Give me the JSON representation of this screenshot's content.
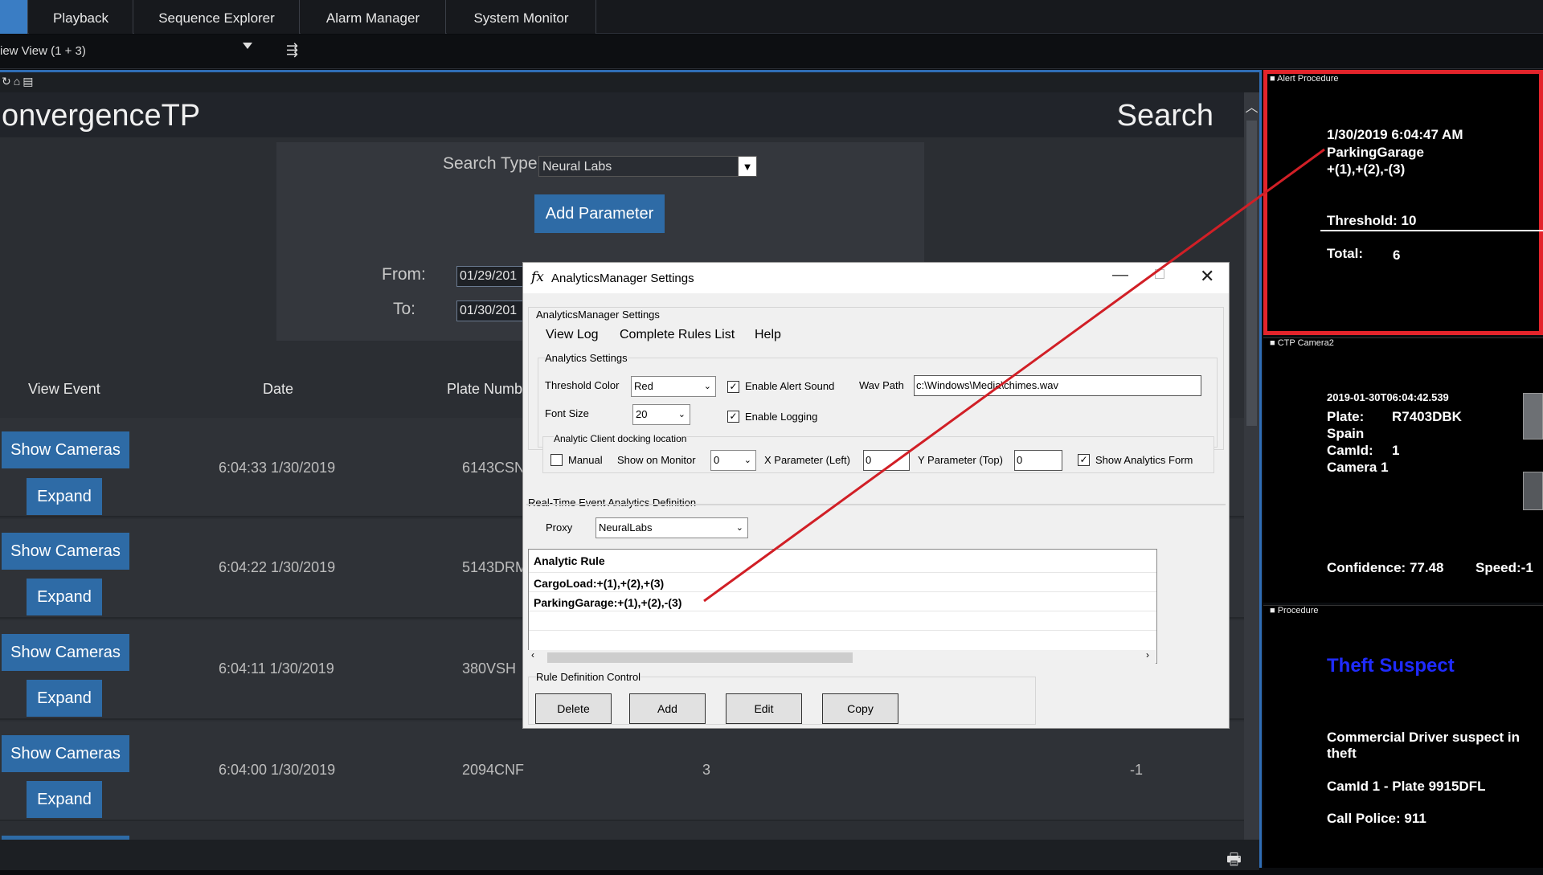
{
  "tabs": [
    {
      "label": "Playback"
    },
    {
      "label": "Sequence Explorer"
    },
    {
      "label": "Alarm Manager"
    },
    {
      "label": "System Monitor"
    }
  ],
  "view": {
    "label": "iew View (1 + 3)"
  },
  "toolbar": {
    "icons": [
      "refresh-icon",
      "home-icon",
      "print-icon"
    ]
  },
  "header": {
    "brand": "onvergenceTP",
    "title": "Search"
  },
  "search": {
    "type_label": "Search Type",
    "type_value": "Neural Labs",
    "add_parameter": "Add Parameter",
    "from_label": "From:",
    "to_label": "To:",
    "from_value": "01/29/201",
    "to_value": "01/30/201"
  },
  "table": {
    "columns": [
      "View Event",
      "Date",
      "Plate Numb"
    ],
    "show_cameras_label": "Show Cameras",
    "expand_label": "Expand",
    "rows": [
      {
        "date": "6:04:33 1/30/2019",
        "plate": "6143CSN"
      },
      {
        "date": "6:04:22 1/30/2019",
        "plate": "5143DRM"
      },
      {
        "date": "6:04:11 1/30/2019",
        "plate": "380VSH"
      },
      {
        "date": "6:04:00 1/30/2019",
        "plate": "2094CNF",
        "value": "3",
        "extra": "-1"
      }
    ]
  },
  "dialog": {
    "title": "AnalyticsManager Settings",
    "group_title": "AnalyticsManager Settings",
    "menu": [
      "View Log",
      "Complete Rules List",
      "Help"
    ],
    "analytics_settings": "Analytics Settings",
    "threshold_color_label": "Threshold Color",
    "threshold_color_value": "Red",
    "enable_alert_sound": "Enable Alert Sound",
    "wav_path_label": "Wav Path",
    "wav_path_value": "c:\\Windows\\Media\\chimes.wav",
    "font_size_label": "Font Size",
    "font_size_value": "20",
    "enable_logging": "Enable Logging",
    "docking_label": "Analytic Client docking location",
    "manual_label": "Manual",
    "show_on_monitor_label": "Show on Monitor",
    "show_on_monitor_value": "0",
    "x_param_label": "X Parameter (Left)",
    "x_param_value": "0",
    "y_param_label": "Y Parameter (Top)",
    "y_param_value": "0",
    "show_analytics_form": "Show Analytics Form",
    "checks": {
      "enable_alert_sound": true,
      "enable_logging": true,
      "manual": false,
      "show_analytics_form": true
    },
    "realtime_label": "Real-Time Event Analytics Definition",
    "proxy_label": "Proxy",
    "proxy_value": "NeuralLabs",
    "rule_header": "Analytic Rule",
    "rules": [
      "CargoLoad:+(1),+(2),+(3)",
      "ParkingGarage:+(1),+(2),-(3)"
    ],
    "rule_control_label": "Rule Definition Control",
    "buttons": [
      "Delete",
      "Add",
      "Edit",
      "Copy"
    ]
  },
  "monitors": {
    "alert": {
      "title": "Alert Procedure",
      "datetime": "1/30/2019 6:04:47 AM",
      "name": "ParkingGarage",
      "rule": "+(1),+(2),-(3)",
      "threshold": "Threshold:  10",
      "total_label": "Total:",
      "total_value": "6"
    },
    "camera": {
      "title": "CTP Camera2",
      "timestamp": "2019-01-30T06:04:42.539",
      "plate_label": "Plate:",
      "plate_value": "R7403DBK",
      "country": "Spain",
      "camid_label": "CamId:",
      "camid_value": "1",
      "camera_name": "Camera 1",
      "confidence": "Confidence: 77.48",
      "speed": "Speed:-1"
    },
    "procedure": {
      "title": "Procedure",
      "headline": "Theft Suspect",
      "description": "Commercial Driver suspect in theft",
      "camid_plate": "CamId 1 - Plate 9915DFL",
      "call": "Call Police:  911"
    }
  },
  "colors": {
    "accent": "#2e6ba6",
    "alert_border": "#e3242b",
    "connector_line": "#d11f26",
    "headline": "#1f2bff"
  }
}
